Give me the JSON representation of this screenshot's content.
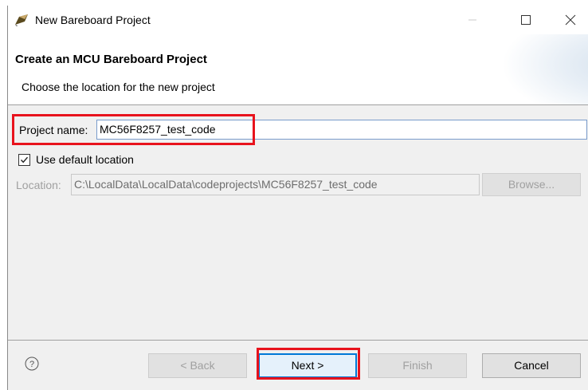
{
  "window": {
    "title": "New Bareboard Project",
    "icons": {
      "app": "eclipse-pen-icon",
      "minimize": "minimize-icon",
      "maximize": "maximize-icon",
      "close": "close-icon"
    }
  },
  "header": {
    "title": "Create an MCU Bareboard Project",
    "description": "Choose the location for the new project"
  },
  "form": {
    "project_name_label": "Project name:",
    "project_name_value": "MC56F8257_test_code",
    "use_default_location_label": "Use default location",
    "use_default_location_checked": true,
    "location_label": "Location:",
    "location_value": "C:\\LocalData\\LocalData\\codeprojects\\MC56F8257_test_code",
    "browse_label": "Browse..."
  },
  "footer": {
    "help_icon": "help-question-icon",
    "back_label": "< Back",
    "next_label": "Next >",
    "finish_label": "Finish",
    "cancel_label": "Cancel"
  },
  "colors": {
    "highlight_red": "#e8131d",
    "focus_blue": "#0078d7",
    "dialog_bg": "#f0f0f0"
  }
}
